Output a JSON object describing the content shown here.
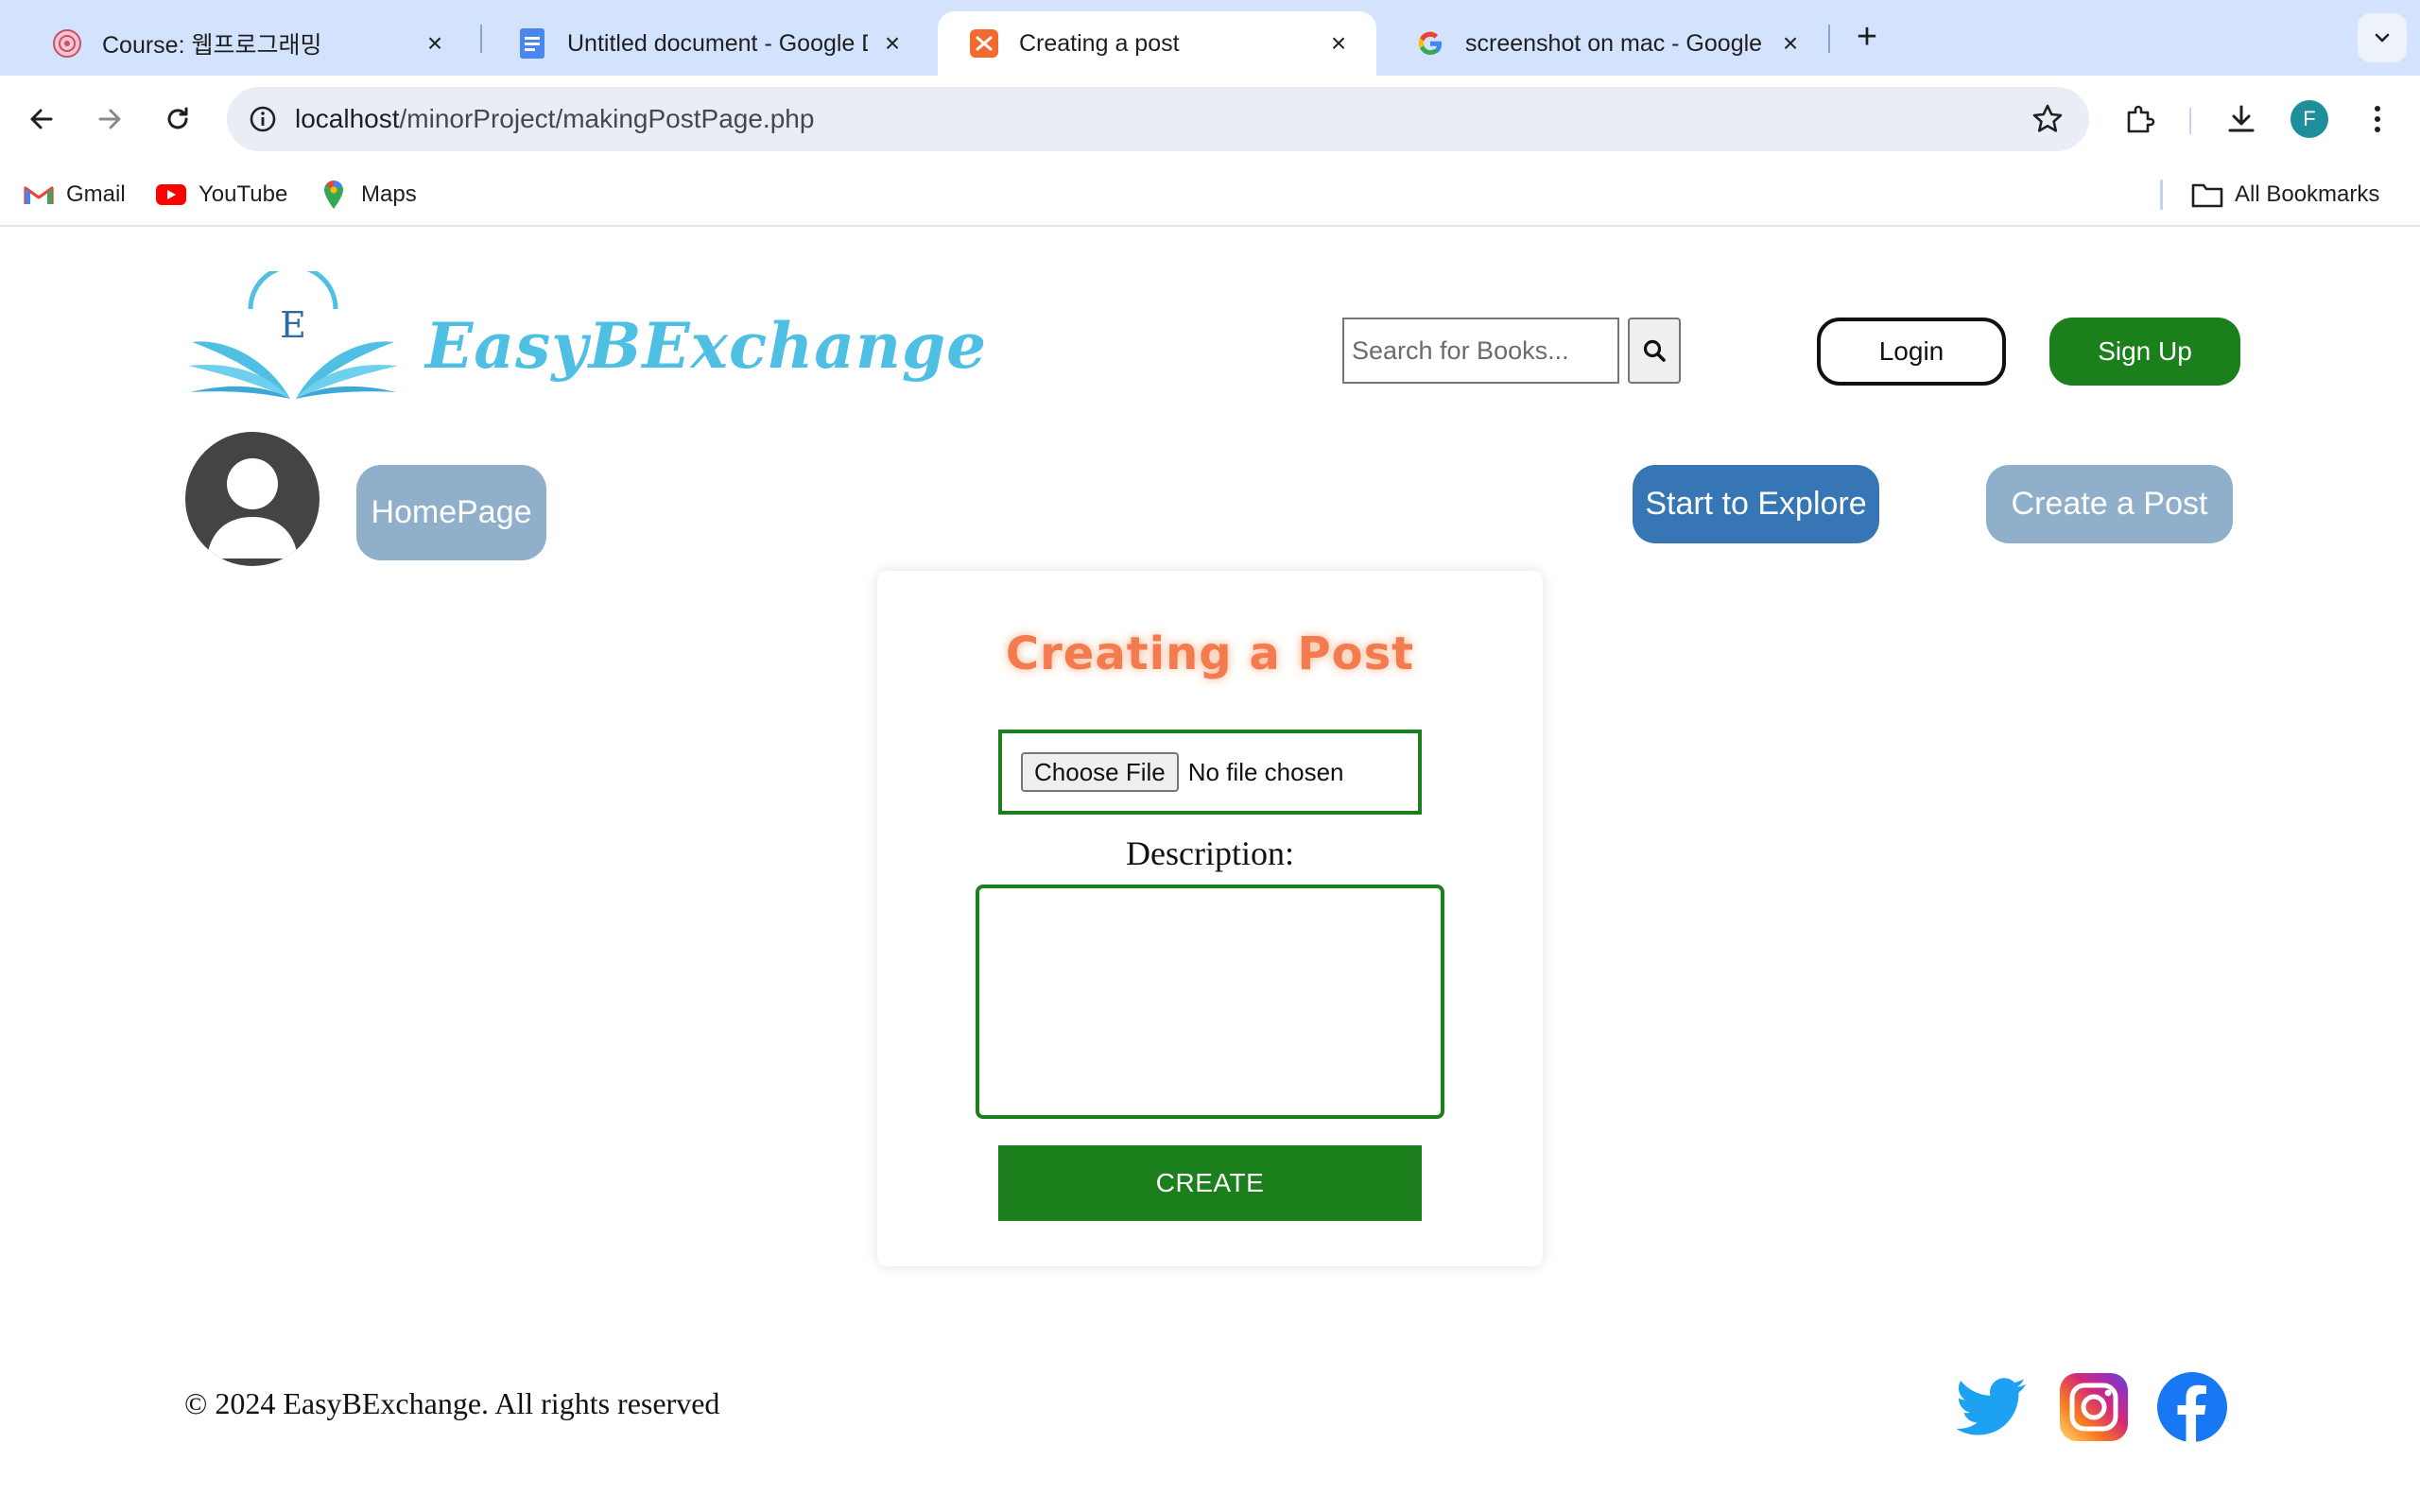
{
  "browser": {
    "tabs": [
      {
        "title": "Course: 웹프로그래밍",
        "icon": "course-seal-icon"
      },
      {
        "title": "Untitled document - Google D",
        "icon": "google-docs-icon"
      },
      {
        "title": "Creating a post",
        "icon": "xampp-icon",
        "active": true
      },
      {
        "title": "screenshot on mac - Google S",
        "icon": "google-g-icon"
      }
    ],
    "url_host": "localhost",
    "url_path": "/minorProject/makingPostPage.php",
    "profile_initial": "F",
    "bookmarks": [
      {
        "label": "Gmail",
        "icon": "gmail-icon"
      },
      {
        "label": "YouTube",
        "icon": "youtube-icon"
      },
      {
        "label": "Maps",
        "icon": "maps-pin-icon"
      }
    ],
    "all_bookmarks_label": "All Bookmarks"
  },
  "header": {
    "logo_text": "EasyBExchange",
    "logo_letter": "E",
    "search_placeholder": "Search for Books...",
    "login_label": "Login",
    "signup_label": "Sign Up"
  },
  "nav": {
    "homepage_label": "HomePage",
    "explore_label": "Start to Explore",
    "create_post_label": "Create a Post"
  },
  "form": {
    "title": "Creating a Post",
    "choose_file_label": "Choose File",
    "no_file_text": "No file chosen",
    "description_label": "Description:",
    "description_value": "",
    "create_label": "CREATE"
  },
  "footer": {
    "copyright": "© 2024 EasyBExchange. All rights reserved",
    "social": [
      "twitter-icon",
      "instagram-icon",
      "facebook-icon"
    ]
  },
  "colors": {
    "tabstrip_bg": "#d3e3fd",
    "brand_green": "#1b7f1b",
    "explore_blue": "#3676b5",
    "muted_blue": "#8fafcb",
    "title_orange": "#f47a4f",
    "logo_blue": "#4fc0e4"
  }
}
